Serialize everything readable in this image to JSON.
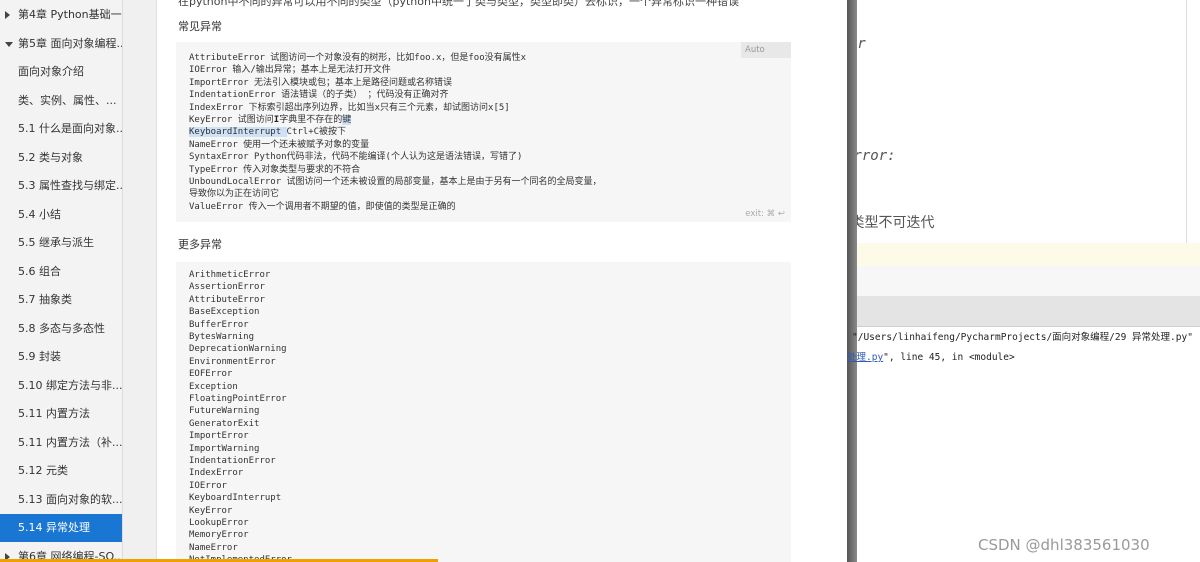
{
  "sidebar": {
    "items": [
      {
        "label": "第4章 Python基础一...",
        "caret": "right"
      },
      {
        "label": "第5章 面向对象编程...",
        "caret": "down"
      },
      {
        "label": "面向对象介绍"
      },
      {
        "label": "类、实例、属性、..."
      },
      {
        "label": "5.1 什么是面向对象..."
      },
      {
        "label": "5.2 类与对象"
      },
      {
        "label": "5.3 属性查找与绑定..."
      },
      {
        "label": "5.4 小结"
      },
      {
        "label": "5.5 继承与派生"
      },
      {
        "label": "5.6 组合"
      },
      {
        "label": "5.7 抽象类"
      },
      {
        "label": "5.8 多态与多态性"
      },
      {
        "label": "5.9 封装"
      },
      {
        "label": "5.10 绑定方法与非..."
      },
      {
        "label": "5.11 内置方法"
      },
      {
        "label": "5.11 内置方法（补..."
      },
      {
        "label": "5.12 元类"
      },
      {
        "label": "5.13 面向对象的软..."
      },
      {
        "label": "5.14 异常处理",
        "active": true
      },
      {
        "label": "第6章 网络编程-SO...",
        "caret": "right"
      }
    ]
  },
  "article": {
    "intro": "在python中不同的异常可以用不同的类型（python中统一了类与类型，类型即类）去标识，一个异常标识一种错误",
    "common_title": "常见异常",
    "common_auto": "Auto",
    "common_exit_hint": "exit: ⌘ ↩",
    "common_lines": [
      "AttributeError 试图访问一个对象没有的树形，比如foo.x，但是foo没有属性x",
      "IOError 输入/输出异常；基本上是无法打开文件",
      "ImportError 无法引入模块或包；基本上是路径问题或名称错误",
      "IndentationError 语法错误（的子类） ；代码没有正确对齐",
      "IndexError 下标索引超出序列边界，比如当x只有三个元素，却试图访问x[5]",
      "KeyError 试图访问字典里不存在的键",
      "KeyboardInterrupt Ctrl+C被按下",
      "NameError 使用一个还未被赋予对象的变量",
      "SyntaxError Python代码非法，代码不能编译(个人认为这是语法错误，写错了)",
      "TypeError 传入对象类型与要求的不符合",
      "UnboundLocalError 试图访问一个还未被设置的局部变量，基本上是由于另有一个同名的全局变量，",
      "导致你以为正在访问它",
      "ValueError 传入一个调用者不期望的值，即使值的类型是正确的"
    ],
    "key_error": {
      "before": "KeyError 试图访问",
      "cursor": "I",
      "after": "字典里不存在的",
      "hl": "键"
    },
    "kb_interrupt": {
      "hl": "KeyboardInterrupt ",
      "rest": "Ctrl+C被按下"
    },
    "more_title": "更多异常",
    "more_lines": [
      "ArithmeticError",
      "AssertionError",
      "AttributeError",
      "BaseException",
      "BufferError",
      "BytesWarning",
      "DeprecationWarning",
      "EnvironmentError",
      "EOFError",
      "Exception",
      "FloatingPointError",
      "FutureWarning",
      "GeneratorExit",
      "ImportError",
      "ImportWarning",
      "IndentationError",
      "IndexError",
      "IOError",
      "KeyboardInterrupt",
      "KeyError",
      "LookupError",
      "MemoryError",
      "NameError",
      "NotImplementedError"
    ]
  },
  "ide": {
    "frag_or": "or",
    "frag_error": "Error:",
    "frag_iter": "t类型不可迭代",
    "console_path": "\"/Users/linhaifeng/PycharmProjects/面向对象编程/29 异常处理.py\"",
    "console_link": "处理.py",
    "console_rest": "\", line 45, in <module>"
  },
  "watermark": "CSDN @dhl383561030",
  "colors": {
    "accent": "#1976d2",
    "progress": "#f0a000",
    "highlight": "#cfe1f7"
  }
}
